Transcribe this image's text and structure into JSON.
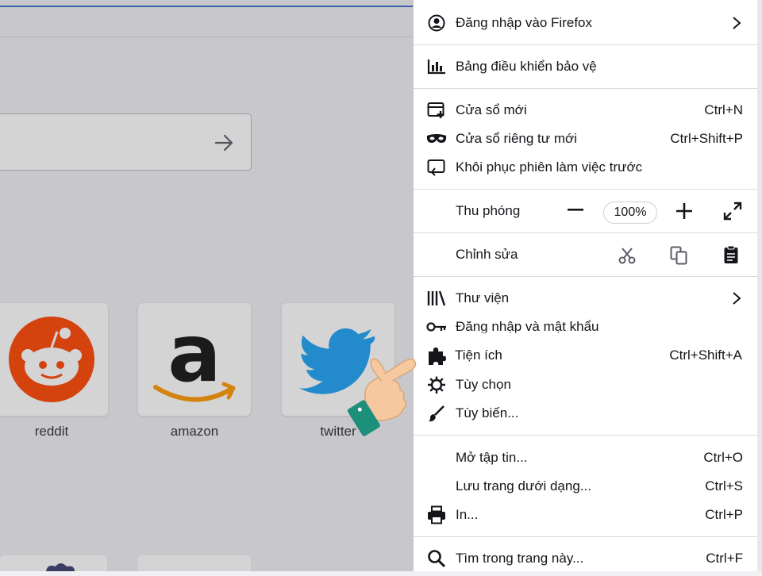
{
  "browser": {
    "topsites": [
      {
        "label": "reddit",
        "icon": "reddit-icon",
        "color": "#ff4500"
      },
      {
        "label": "amazon",
        "icon": "amazon-icon",
        "color": "#ff9900"
      },
      {
        "label": "twitter",
        "icon": "twitter-icon",
        "color": "#1da1f2"
      }
    ]
  },
  "menu": {
    "signin": {
      "label": "Đăng nhập vào Firefox",
      "icon": "account-icon"
    },
    "protections": {
      "label": "Bảng điều khiển bảo vệ",
      "icon": "chart-icon"
    },
    "new_window": {
      "label": "Cửa sổ mới",
      "shortcut": "Ctrl+N",
      "icon": "new-window-icon"
    },
    "private_window": {
      "label": "Cửa sổ riêng tư mới",
      "shortcut": "Ctrl+Shift+P",
      "icon": "mask-icon"
    },
    "restore_session": {
      "label": "Khôi phục phiên làm việc trước",
      "icon": "restore-icon"
    },
    "zoom": {
      "label": "Thu phóng",
      "value": "100%",
      "minus": "−",
      "plus": "+"
    },
    "edit": {
      "label": "Chỉnh sửa",
      "icons": [
        "cut-icon",
        "copy-icon",
        "paste-icon"
      ]
    },
    "library": {
      "label": "Thư viện",
      "icon": "library-icon"
    },
    "logins": {
      "label": "Đăng nhập và mật khẩu",
      "icon": "key-icon"
    },
    "addons": {
      "label": "Tiện ích",
      "shortcut": "Ctrl+Shift+A",
      "icon": "puzzle-icon"
    },
    "options": {
      "label": "Tùy chọn",
      "icon": "gear-icon"
    },
    "customize": {
      "label": "Tùy biến...",
      "icon": "brush-icon"
    },
    "open_file": {
      "label": "Mở tập tin...",
      "shortcut": "Ctrl+O"
    },
    "save_page": {
      "label": "Lưu trang dưới dạng...",
      "shortcut": "Ctrl+S"
    },
    "print": {
      "label": "In...",
      "shortcut": "Ctrl+P",
      "icon": "printer-icon"
    },
    "find": {
      "label": "Tìm trong trang này...",
      "shortcut": "Ctrl+F",
      "icon": "search-icon"
    }
  },
  "colors": {
    "accent": "#3b6fc4",
    "highlight_bg": "#ffffff",
    "hand_cuff": "#1e8f7a",
    "hand_skin": "#f6c89f"
  }
}
